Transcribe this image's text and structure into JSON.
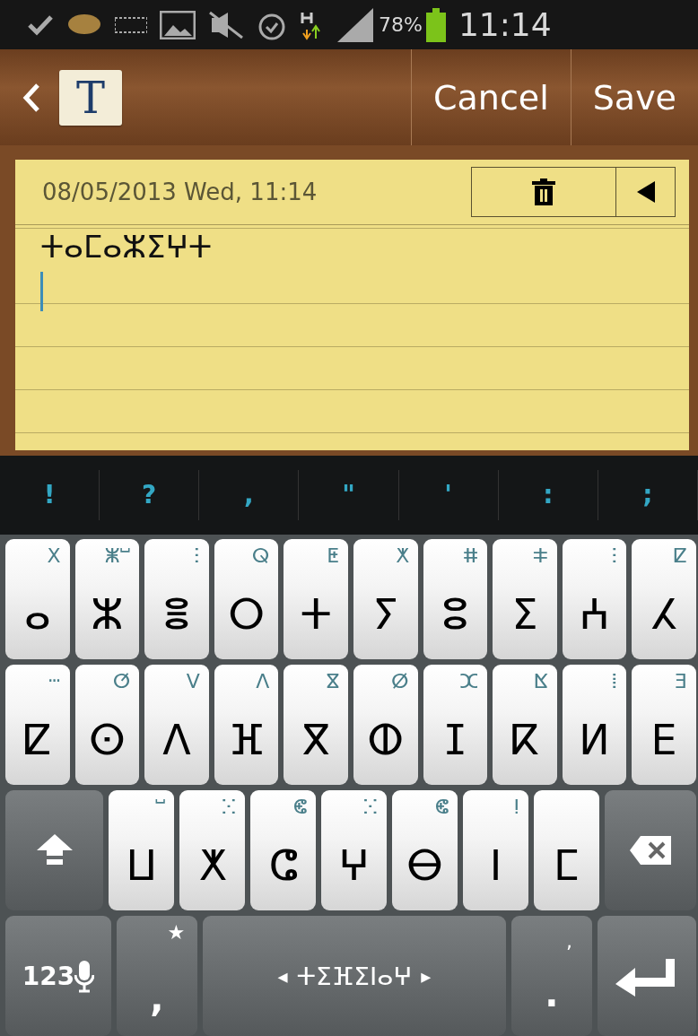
{
  "status_bar": {
    "battery": "78%",
    "time": "11:14"
  },
  "header": {
    "app_icon": "T",
    "actions": [
      "Cancel",
      "Save"
    ]
  },
  "note": {
    "date": "08/05/2013 Wed, 11:14",
    "text": "ⵜⴰⵎⴰⵣⵉⵖⵜ"
  },
  "suggestions": [
    "!",
    "?",
    ",",
    "\"",
    "'",
    ":",
    ";"
  ],
  "keyboard": {
    "rows": [
      [
        {
          "main": "ⴰ",
          "alt": "ⵝ"
        },
        {
          "main": "ⵣ",
          "alt": "ⵥⵯ"
        },
        {
          "main": "ⴻ",
          "alt": "ⵗ"
        },
        {
          "main": "ⵔ",
          "alt": "ⵕ"
        },
        {
          "main": "ⵜ",
          "alt": "ⵟ"
        },
        {
          "main": "ⵢ",
          "alt": "ⵅ"
        },
        {
          "main": "ⵓ",
          "alt": "ⵌ"
        },
        {
          "main": "ⵉ",
          "alt": "ⵐ"
        },
        {
          "main": "ⵄ",
          "alt": "ⵗ"
        },
        {
          "main": "ⵃ",
          "alt": "ⵇ"
        }
      ],
      [
        {
          "main": "ⵇ",
          "alt": "ⵈ"
        },
        {
          "main": "ⵙ",
          "alt": "ⵚ"
        },
        {
          "main": "ⴷ",
          "alt": "ⴸ"
        },
        {
          "main": "ⴼ",
          "alt": "ⴷ"
        },
        {
          "main": "ⴳ",
          "alt": "ⴵ"
        },
        {
          "main": "ⵀ",
          "alt": "ⵁ"
        },
        {
          "main": "ⵊ",
          "alt": "ⵋ"
        },
        {
          "main": "ⴽ",
          "alt": "ⴿ"
        },
        {
          "main": "ⵍ",
          "alt": "ⵂ"
        },
        {
          "main": "ⴹ",
          "alt": "ⴺ"
        }
      ],
      [
        {
          "main": "ⵡ",
          "alt": "ⵯ"
        },
        {
          "main": "ⵅ",
          "alt": "ⵘ"
        },
        {
          "main": "ⵛ",
          "alt": "ⵞ"
        },
        {
          "main": "ⵖ",
          "alt": "ⵘ"
        },
        {
          "main": "ⴱ",
          "alt": "ⵞ"
        },
        {
          "main": "ⵏ",
          "alt": "ⵑ"
        },
        {
          "main": "ⵎ"
        }
      ]
    ],
    "numbers_key": "123",
    "comma_key": {
      "main": ",",
      "alt": "★"
    },
    "space_key": {
      "left": "◂",
      "label": "ⵜⵉⴼⵉⵏⴰⵖ",
      "right": "▸"
    },
    "period_key": {
      "main": ".",
      "alt": ","
    }
  }
}
